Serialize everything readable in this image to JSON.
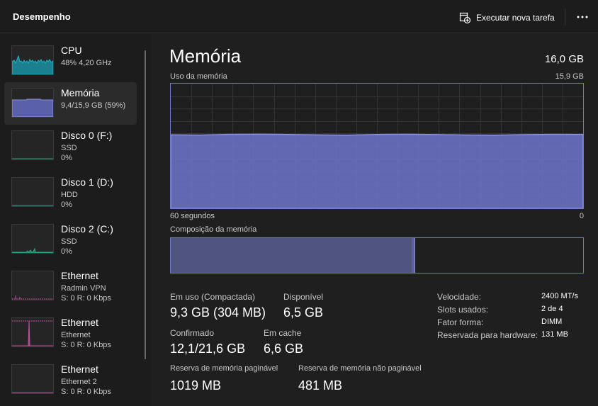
{
  "app": {
    "title": "Desempenho",
    "run_task_label": "Executar nova tarefa"
  },
  "sidebar": {
    "items": [
      {
        "name": "CPU",
        "line2": "48% 4,20 GHz",
        "line3": "",
        "color": "#1fb5c7",
        "selected": false
      },
      {
        "name": "Memória",
        "line2": "9,4/15,9 GB (59%)",
        "line3": "",
        "color": "#6f76cc",
        "selected": true
      },
      {
        "name": "Disco 0 (F:)",
        "line2": "SSD",
        "line3": "0%",
        "color": "#2aa68a",
        "selected": false
      },
      {
        "name": "Disco 1 (D:)",
        "line2": "HDD",
        "line3": "0%",
        "color": "#2aa68a",
        "selected": false
      },
      {
        "name": "Disco 2 (C:)",
        "line2": "SSD",
        "line3": "0%",
        "color": "#2aa68a",
        "selected": false
      },
      {
        "name": "Ethernet",
        "line2": "Radmin VPN",
        "line3": "S: 0 R: 0 Kbps",
        "color": "#c24f9e",
        "selected": false
      },
      {
        "name": "Ethernet",
        "line2": "Ethernet",
        "line3": "S: 0 R: 0 Kbps",
        "color": "#c24f9e",
        "selected": false
      },
      {
        "name": "Ethernet",
        "line2": "Ethernet 2",
        "line3": "S: 0 R: 0 Kbps",
        "color": "#c24f9e",
        "selected": false
      }
    ]
  },
  "memory": {
    "title": "Memória",
    "total": "16,0 GB",
    "graph_label": "Uso da memória",
    "graph_max": "15,9 GB",
    "axis_left": "60 segundos",
    "axis_right": "0",
    "usage_fraction": 0.59,
    "composition_label": "Composição da memória",
    "stats": {
      "in_use_label": "Em uso (Compactada)",
      "in_use_value": "9,3 GB (304 MB)",
      "available_label": "Disponível",
      "available_value": "6,5 GB",
      "committed_label": "Confirmado",
      "committed_value": "12,1/21,6 GB",
      "cached_label": "Em cache",
      "cached_value": "6,6 GB",
      "paged_label": "Reserva de memória paginável",
      "paged_value": "1019 MB",
      "nonpaged_label": "Reserva de memória não paginável",
      "nonpaged_value": "481 MB"
    },
    "details": {
      "speed_key": "Velocidade:",
      "speed_val": "2400 MT/s",
      "slots_key": "Slots usados:",
      "slots_val": "2 de 4",
      "form_key": "Fator forma:",
      "form_val": "DIMM",
      "reserved_key": "Reservada para hardware:",
      "reserved_val": "131 MB"
    }
  },
  "colors": {
    "memory_fill": "#6f76cc",
    "memory_line": "#8b92e0"
  }
}
